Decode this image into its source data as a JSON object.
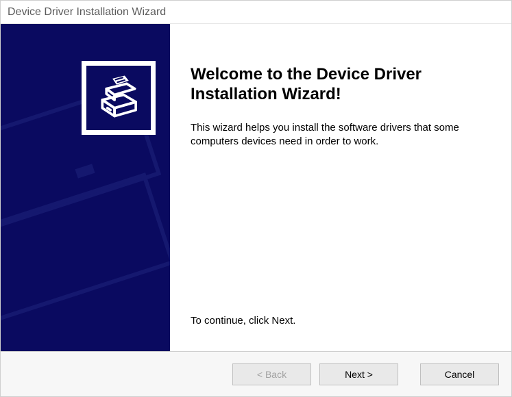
{
  "window": {
    "title": "Device Driver Installation Wizard"
  },
  "main": {
    "heading": "Welcome to the Device Driver Installation Wizard!",
    "body": "This wizard helps you install the software drivers that some computers devices need in order to work.",
    "continue": "To continue, click Next."
  },
  "buttons": {
    "back": "< Back",
    "next": "Next >",
    "cancel": "Cancel"
  }
}
